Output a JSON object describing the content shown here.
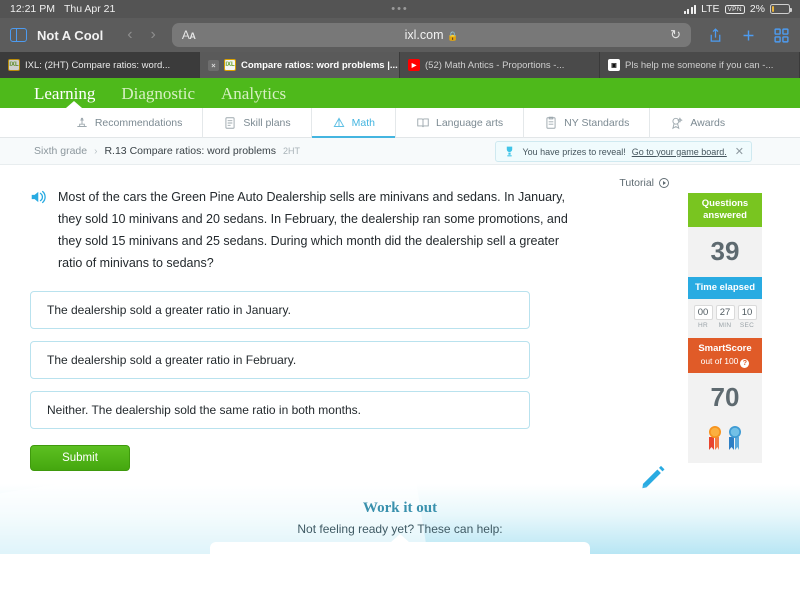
{
  "status_bar": {
    "time": "12:21 PM",
    "date": "Thu Apr 21",
    "center_dots": "•••",
    "network": "LTE",
    "vpn": "VPN",
    "battery_percent": "2%"
  },
  "browser": {
    "profile_name": "Not A Cool",
    "back_glyph": "‹",
    "forward_glyph": "›",
    "aa_label": "AA",
    "url": "ixl.com",
    "lock_glyph": "🔒",
    "reload_glyph": "↻",
    "tabs": [
      {
        "title": "IXL: (2HT) Compare ratios: word...",
        "favicon": "ixl-favicon",
        "state": "inactive",
        "close": ""
      },
      {
        "title": "Compare ratios: word problems |...",
        "favicon": "ixl-favicon",
        "state": "current",
        "close": "×"
      },
      {
        "title": "(52) Math Antics - Proportions -...",
        "favicon": "youtube-favicon",
        "state": "inactive",
        "close": ""
      },
      {
        "title": "Pls help me someone if you can -...",
        "favicon": "roblox-favicon",
        "state": "inactive",
        "close": ""
      }
    ]
  },
  "ixl_header": {
    "nav": [
      {
        "label": "Learning",
        "active": true
      },
      {
        "label": "Diagnostic",
        "active": false
      },
      {
        "label": "Analytics",
        "active": false
      }
    ],
    "subnav": [
      {
        "label": "Recommendations",
        "icon": "recommendations-icon",
        "active": false
      },
      {
        "label": "Skill plans",
        "icon": "skill-plans-icon",
        "active": false
      },
      {
        "label": "Math",
        "icon": "math-icon",
        "active": true
      },
      {
        "label": "Language arts",
        "icon": "language-arts-icon",
        "active": false
      },
      {
        "label": "NY Standards",
        "icon": "standards-icon",
        "active": false
      },
      {
        "label": "Awards",
        "icon": "awards-icon",
        "active": false
      }
    ]
  },
  "breadcrumb": {
    "grade": "Sixth grade",
    "separator": "›",
    "skill": "R.13 Compare ratios: word problems",
    "code": "2HT"
  },
  "prize_toast": {
    "icon": "trophy-icon",
    "text": "You have prizes to reveal!",
    "link": "Go to your game board.",
    "close": "✕"
  },
  "question": {
    "speaker_icon": "speaker-icon",
    "text": "Most of the cars the Green Pine Auto Dealership sells are minivans and sedans. In January, they sold 10 minivans and 20 sedans. In February, the dealership ran some promotions, and they sold 15 minivans and 25 sedans. During which month did the dealership sell a greater ratio of minivans to sedans?",
    "choices": [
      "The dealership sold a greater ratio in January.",
      "The dealership sold a greater ratio in February.",
      "Neither. The dealership sold the same ratio in both months."
    ],
    "submit_label": "Submit"
  },
  "tutorial": {
    "label": "Tutorial",
    "icon": "play-circle-icon"
  },
  "score_panel": {
    "questions_answered_label": "Questions answered",
    "questions_answered_value": "39",
    "time_elapsed_label": "Time elapsed",
    "timer": [
      {
        "value": "00",
        "label": "HR"
      },
      {
        "value": "27",
        "label": "MIN"
      },
      {
        "value": "10",
        "label": "SEC"
      }
    ],
    "smartscore_label": "SmartScore",
    "smartscore_sub": "out of 100",
    "smartscore_help": "?",
    "smartscore_value": "70",
    "medals_icon": "award-ribbons-icon"
  },
  "pencil_icon": "pencil-icon",
  "work_it_out": {
    "title": "Work it out",
    "subtitle": "Not feeling ready yet? These can help:"
  },
  "colors": {
    "ixl_green": "#4eb91b",
    "accent_blue": "#44b5e0",
    "smartscore_orange": "#e05b28",
    "questions_green": "#79c520",
    "time_blue": "#29abe2",
    "submit_green": "#4fb016"
  }
}
